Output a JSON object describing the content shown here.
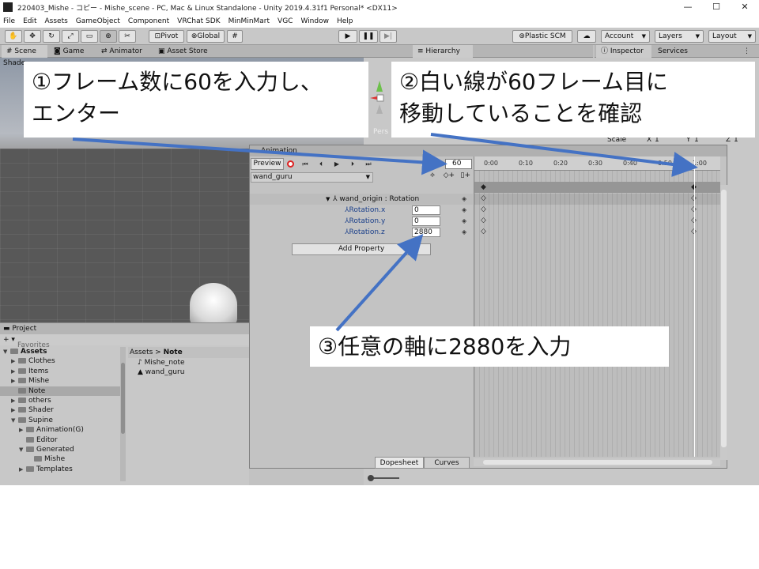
{
  "window": {
    "title": "220403_Mishe - コピー - Mishe_scene - PC, Mac & Linux Standalone - Unity 2019.4.31f1 Personal* <DX11>",
    "min": "—",
    "max": "☐",
    "close": "✕"
  },
  "menu": [
    "File",
    "Edit",
    "Assets",
    "GameObject",
    "Component",
    "VRChat SDK",
    "MinMinMart",
    "VGC",
    "Window",
    "Help"
  ],
  "toolbar": {
    "pivot": "Pivot",
    "global": "Global",
    "play": "▶",
    "pause": "❚❚",
    "step": "▶|",
    "plastic": "Plastic SCM",
    "account": "Account",
    "layers": "Layers",
    "layout": "Layout"
  },
  "tabs": {
    "scene": "Scene",
    "game": "Game",
    "animator": "Animator",
    "asset_store": "Asset Store",
    "hierarchy": "Hierarchy",
    "inspector": "Inspector",
    "services": "Services"
  },
  "scene": {
    "shading": "Shade",
    "persp": "Pers"
  },
  "inspector": {
    "scale_label": "Scale",
    "x": "X",
    "x_val": "1",
    "y": "Y",
    "y_val": "1",
    "z": "Z",
    "z_val": "1"
  },
  "project": {
    "title": "Project",
    "add": "+ ▾",
    "favorites": "Favorites",
    "tree": [
      {
        "label": "Assets",
        "indent": 0,
        "arrow": "▼",
        "bold": true
      },
      {
        "label": "Clothes",
        "indent": 1,
        "arrow": "▶"
      },
      {
        "label": "Items",
        "indent": 1,
        "arrow": "▶"
      },
      {
        "label": "Mishe",
        "indent": 1,
        "arrow": "▶"
      },
      {
        "label": "Note",
        "indent": 1,
        "arrow": "",
        "selected": true
      },
      {
        "label": "others",
        "indent": 1,
        "arrow": "▶"
      },
      {
        "label": "Shader",
        "indent": 1,
        "arrow": "▶"
      },
      {
        "label": "Supine",
        "indent": 1,
        "arrow": "▼"
      },
      {
        "label": "Animation(G)",
        "indent": 2,
        "arrow": "▶"
      },
      {
        "label": "Editor",
        "indent": 2,
        "arrow": ""
      },
      {
        "label": "Generated",
        "indent": 2,
        "arrow": "▼"
      },
      {
        "label": "Mishe",
        "indent": 3,
        "arrow": ""
      },
      {
        "label": "Templates",
        "indent": 2,
        "arrow": "▶"
      }
    ],
    "breadcrumb_root": "Assets",
    "breadcrumb_sep": ">",
    "breadcrumb_leaf": "Note",
    "assets": [
      "Mishe_note",
      "wand_guru"
    ]
  },
  "animation": {
    "title": "Animation",
    "preview": "Preview",
    "frame": "60",
    "clip": "wand_guru",
    "group": "wand_origin : Rotation",
    "props": [
      {
        "label": "Rotation.x",
        "value": "0"
      },
      {
        "label": "Rotation.y",
        "value": "0"
      },
      {
        "label": "Rotation.z",
        "value": "2880"
      }
    ],
    "add_property": "Add Property",
    "ticks": [
      "0:00",
      "0:10",
      "0:20",
      "0:30",
      "0:40",
      "0:50",
      "1:00"
    ],
    "tab_dopesheet": "Dopesheet",
    "tab_curves": "Curves"
  },
  "callouts": {
    "c1_line1": "①フレーム数に60を入力し、",
    "c1_line2": "エンター",
    "c2_line1": "②白い線が60フレーム目に",
    "c2_line2": "移動していることを確認",
    "c3": "③任意の軸に2880を入力"
  },
  "colors": {
    "accent_arrow": "#4472c4",
    "record": "#dd2222",
    "panel": "#c8c8c8"
  }
}
